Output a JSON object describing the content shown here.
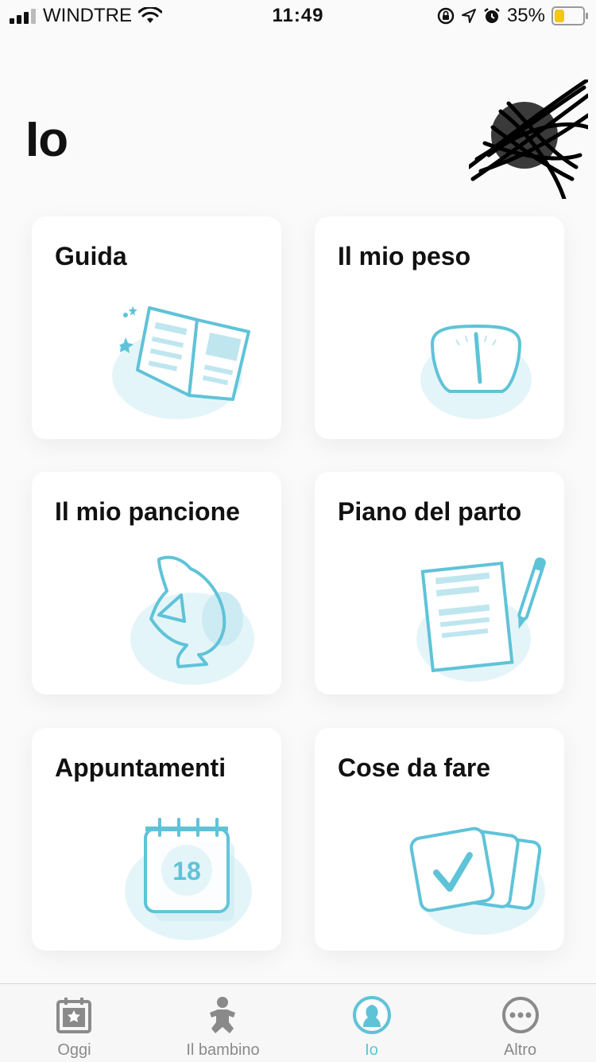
{
  "status_bar": {
    "carrier": "WINDTRE",
    "time": "11:49",
    "battery": "35%",
    "battery_level": 0.35
  },
  "page": {
    "title": "Io"
  },
  "cards": [
    {
      "label": "Guida",
      "icon": "book-icon"
    },
    {
      "label": "Il mio peso",
      "icon": "scale-icon"
    },
    {
      "label": "Il mio pancione",
      "icon": "pregnant-belly-icon"
    },
    {
      "label": "Piano del parto",
      "icon": "document-pen-icon"
    },
    {
      "label": "Appuntamenti",
      "icon": "calendar-icon",
      "calendar_day": "18"
    },
    {
      "label": "Cose da fare",
      "icon": "checklist-icon"
    }
  ],
  "tabbar": {
    "tabs": [
      {
        "label": "Oggi",
        "icon": "calendar-star-icon",
        "active": false
      },
      {
        "label": "Il bambino",
        "icon": "baby-icon",
        "active": false
      },
      {
        "label": "Io",
        "icon": "woman-icon",
        "active": true
      },
      {
        "label": "Altro",
        "icon": "more-icon",
        "active": false
      }
    ]
  },
  "colors": {
    "accent": "#5fc3d8",
    "accent_light": "#dff3f8",
    "text": "#111111",
    "inactive_tab": "#8a8a8a"
  }
}
